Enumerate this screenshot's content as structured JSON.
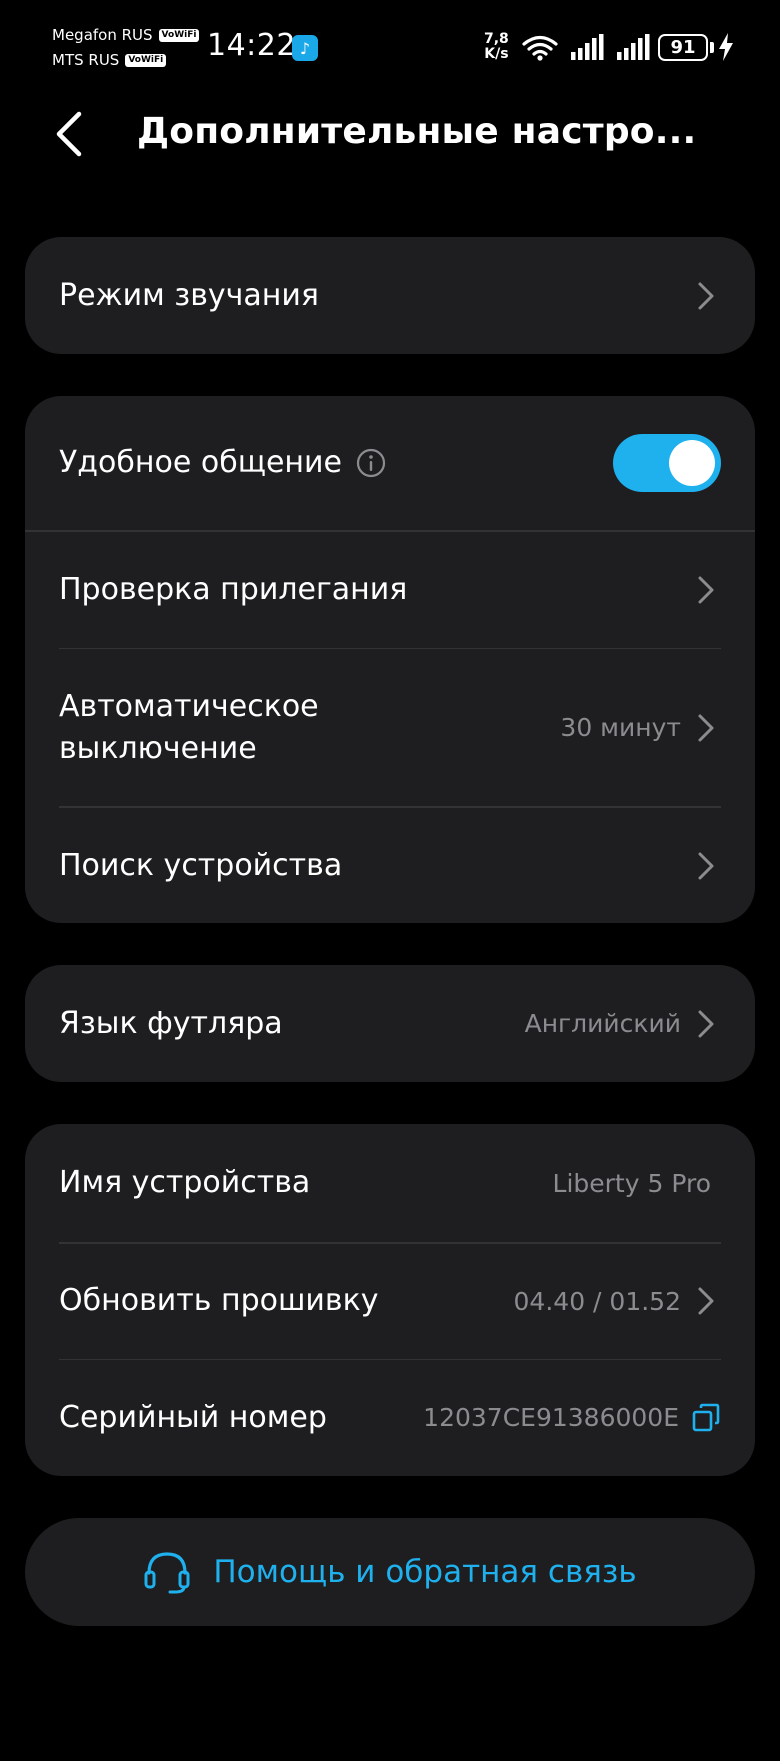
{
  "status_bar": {
    "carrier1": "Megafon RUS",
    "carrier2": "MTS RUS",
    "vowifi": "VoWiFi",
    "time": "14:22",
    "net_speed_value": "7,8",
    "net_speed_unit": "K/s",
    "battery": "91"
  },
  "header": {
    "title": "Дополнительные настро..."
  },
  "sections": {
    "sound_mode": {
      "label": "Режим звучания"
    },
    "comfort_talk": {
      "label": "Удобное общение",
      "toggle_on": true
    },
    "fit_test": {
      "label": "Проверка прилегания"
    },
    "auto_off": {
      "label_line1": "Автоматическое",
      "label_line2": "выключение",
      "value": "30 минут"
    },
    "find_device": {
      "label": "Поиск устройства"
    },
    "case_language": {
      "label": "Язык футляра",
      "value": "Английский"
    },
    "device_name": {
      "label": "Имя устройства",
      "value": "Liberty 5 Pro"
    },
    "firmware": {
      "label": "Обновить прошивку",
      "value": "04.40 / 01.52"
    },
    "serial": {
      "label": "Серийный номер",
      "value": "12037CE91386000E"
    }
  },
  "help": {
    "label": "Помощь и обратная связь"
  },
  "colors": {
    "accent": "#1fb0ee",
    "card": "#1e1e20",
    "background": "#000000"
  }
}
